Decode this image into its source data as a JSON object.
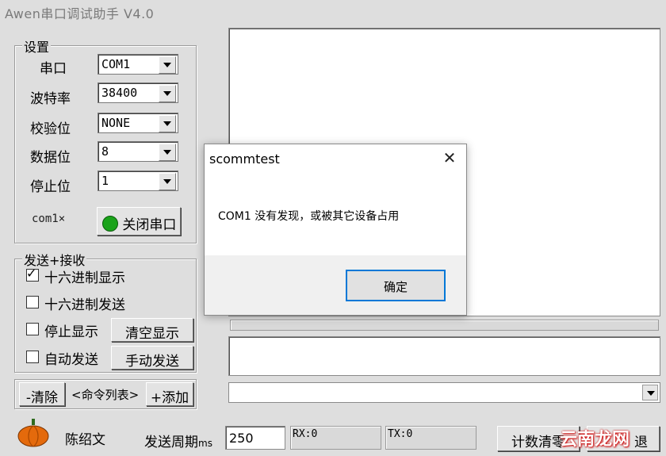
{
  "window": {
    "title": "Awen串口调试助手 V4.0"
  },
  "settings": {
    "legend": "设置",
    "port_label": "串口",
    "port_value": "COM1",
    "baud_label": "波特率",
    "baud_value": "38400",
    "parity_label": "校验位",
    "parity_value": "NONE",
    "databits_label": "数据位",
    "databits_value": "8",
    "stopbits_label": "停止位",
    "stopbits_value": "1",
    "port_status": "com1×",
    "toggle_button": "关闭串口",
    "status_color": "#1aa31a"
  },
  "sendrecv": {
    "legend": "发送+接收",
    "hex_display": "十六进制显示",
    "hex_display_checked": true,
    "hex_send": "十六进制发送",
    "hex_send_checked": false,
    "stop_display": "停止显示",
    "stop_display_checked": false,
    "clear_display": "清空显示",
    "auto_send": "自动发送",
    "auto_send_checked": false,
    "manual_send": "手动发送"
  },
  "commands": {
    "clear": "-清除",
    "list": "<命令列表>",
    "add": "+添加"
  },
  "footer": {
    "author": "陈绍文",
    "period_label": "发送周期",
    "period_unit": "ms",
    "period_value": "250",
    "rx": "RX:0",
    "tx": "TX:0",
    "reset_counts": "计数清零",
    "exit_partial": "退"
  },
  "dialog": {
    "title": "scommtest",
    "message": "COM1 没有发现，或被其它设备占用",
    "ok": "确定"
  },
  "watermark": "云南龙网"
}
